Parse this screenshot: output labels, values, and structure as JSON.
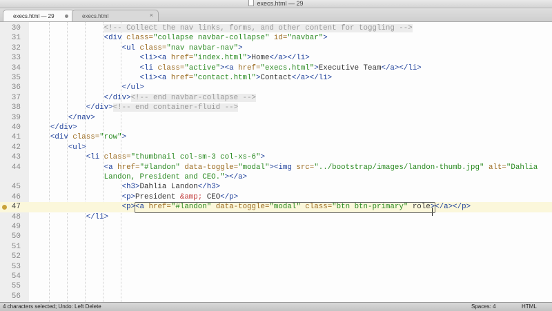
{
  "window": {
    "title": "execs.html — 29"
  },
  "tabs": [
    {
      "label": "execs.html — 29",
      "active": true
    },
    {
      "label": "execs.html",
      "active": false
    }
  ],
  "editor": {
    "lines": [
      {
        "no": "30",
        "indent": 4,
        "tokens": [
          [
            "comment",
            "<!-- Collect the nav links, forms, and other content for toggling -->"
          ]
        ]
      },
      {
        "no": "31",
        "indent": 4,
        "tokens": [
          [
            "tag",
            "<div "
          ],
          [
            "attr",
            "class="
          ],
          [
            "str",
            "\"collapse navbar-collapse\""
          ],
          [
            "attr",
            " id="
          ],
          [
            "str",
            "\"navbar\""
          ],
          [
            "tag",
            ">"
          ]
        ]
      },
      {
        "no": "32",
        "indent": 5,
        "tokens": [
          [
            "tag",
            "<ul "
          ],
          [
            "attr",
            "class="
          ],
          [
            "str",
            "\"nav navbar-nav\""
          ],
          [
            "tag",
            ">"
          ]
        ]
      },
      {
        "no": "33",
        "indent": 6,
        "tokens": [
          [
            "tag",
            "<li><a "
          ],
          [
            "attr",
            "href="
          ],
          [
            "str",
            "\"index.html\""
          ],
          [
            "tag",
            ">"
          ],
          [
            "text",
            "Home"
          ],
          [
            "tag",
            "</a></li>"
          ]
        ]
      },
      {
        "no": "34",
        "indent": 6,
        "tokens": [
          [
            "tag",
            "<li "
          ],
          [
            "attr",
            "class="
          ],
          [
            "str",
            "\"active\""
          ],
          [
            "tag",
            "><a "
          ],
          [
            "attr",
            "href="
          ],
          [
            "str",
            "\"execs.html\""
          ],
          [
            "tag",
            ">"
          ],
          [
            "text",
            "Executive Team"
          ],
          [
            "tag",
            "</a></li>"
          ]
        ]
      },
      {
        "no": "35",
        "indent": 6,
        "tokens": [
          [
            "tag",
            "<li><a "
          ],
          [
            "attr",
            "href="
          ],
          [
            "str",
            "\"contact.html\""
          ],
          [
            "tag",
            ">"
          ],
          [
            "text",
            "Contact"
          ],
          [
            "tag",
            "</a></li>"
          ]
        ]
      },
      {
        "no": "36",
        "indent": 5,
        "tokens": [
          [
            "tag",
            "</ul>"
          ]
        ]
      },
      {
        "no": "37",
        "indent": 4,
        "tokens": [
          [
            "tag",
            "</div>"
          ],
          [
            "comment",
            "<!-- end navbar-collapse -->"
          ]
        ]
      },
      {
        "no": "38",
        "indent": 3,
        "tokens": [
          [
            "tag",
            "</div>"
          ],
          [
            "comment",
            "<!-- end container-fluid -->"
          ]
        ]
      },
      {
        "no": "39",
        "indent": 2,
        "tokens": [
          [
            "tag",
            "</nav>"
          ]
        ]
      },
      {
        "no": "40",
        "indent": 1,
        "tokens": [
          [
            "tag",
            "</div>"
          ]
        ]
      },
      {
        "no": "41",
        "indent": 1,
        "tokens": [
          [
            "tag",
            "<div "
          ],
          [
            "attr",
            "class="
          ],
          [
            "str",
            "\"row\""
          ],
          [
            "tag",
            ">"
          ]
        ]
      },
      {
        "no": "42",
        "indent": 2,
        "tokens": [
          [
            "tag",
            "<ul>"
          ]
        ]
      },
      {
        "no": "43",
        "indent": 3,
        "tokens": [
          [
            "tag",
            "<li "
          ],
          [
            "attr",
            "class="
          ],
          [
            "str",
            "\"thumbnail col-sm-3 col-xs-6\""
          ],
          [
            "tag",
            ">"
          ]
        ]
      },
      {
        "no": "44",
        "indent": 4,
        "tokens": [
          [
            "tag",
            "<a "
          ],
          [
            "attr",
            "href="
          ],
          [
            "str",
            "\"#landon\""
          ],
          [
            "attr",
            " data-toggle="
          ],
          [
            "str",
            "\"modal\""
          ],
          [
            "tag",
            "><img "
          ],
          [
            "attr",
            "src="
          ],
          [
            "str",
            "\"../bootstrap/images/landon-thumb.jpg\""
          ],
          [
            "attr",
            " alt="
          ],
          [
            "str",
            "\"Dahlia"
          ]
        ]
      },
      {
        "no": "",
        "indent": 4,
        "tokens": [
          [
            "str",
            "Landon, President and CEO.\""
          ],
          [
            "tag",
            "></a>"
          ]
        ]
      },
      {
        "no": "45",
        "indent": 5,
        "tokens": [
          [
            "tag",
            "<h3>"
          ],
          [
            "text",
            "Dahlia Landon"
          ],
          [
            "tag",
            "</h3>"
          ]
        ]
      },
      {
        "no": "46",
        "indent": 5,
        "tokens": [
          [
            "tag",
            "<p>"
          ],
          [
            "text",
            "President "
          ],
          [
            "ent",
            "&amp;"
          ],
          [
            "text",
            " CEO"
          ],
          [
            "tag",
            "</p>"
          ]
        ]
      },
      {
        "no": "47",
        "indent": 5,
        "current": true,
        "tokens": [
          [
            "tag",
            "<p><a "
          ],
          [
            "attr",
            "href="
          ],
          [
            "str",
            "\"#landon\""
          ],
          [
            "attr",
            " data-toggle="
          ],
          [
            "str",
            "\"modal\""
          ],
          [
            "attr",
            " class="
          ],
          [
            "str",
            "\"btn btn-primary\""
          ],
          [
            "text",
            " "
          ],
          [
            "sel",
            "role"
          ],
          [
            "tag",
            "></a></p>"
          ]
        ]
      },
      {
        "no": "48",
        "indent": 3,
        "tokens": [
          [
            "tag",
            "</li>"
          ]
        ]
      },
      {
        "no": "49",
        "indent": 0,
        "tokens": []
      },
      {
        "no": "50",
        "indent": 0,
        "tokens": []
      },
      {
        "no": "51",
        "indent": 0,
        "tokens": []
      },
      {
        "no": "52",
        "indent": 0,
        "tokens": []
      },
      {
        "no": "53",
        "indent": 0,
        "tokens": []
      },
      {
        "no": "54",
        "indent": 0,
        "tokens": []
      },
      {
        "no": "55",
        "indent": 0,
        "tokens": []
      },
      {
        "no": "56",
        "indent": 0,
        "tokens": []
      }
    ]
  },
  "status": {
    "left": "4 characters selected; Undo: Left Delete",
    "spaces": "Spaces: 4",
    "syntax": "HTML"
  },
  "colors": {
    "tag": "#1d3f9a",
    "attr": "#9b6b20",
    "string": "#2a8a21",
    "comment": "#999999",
    "selection": "#f5c24a"
  }
}
